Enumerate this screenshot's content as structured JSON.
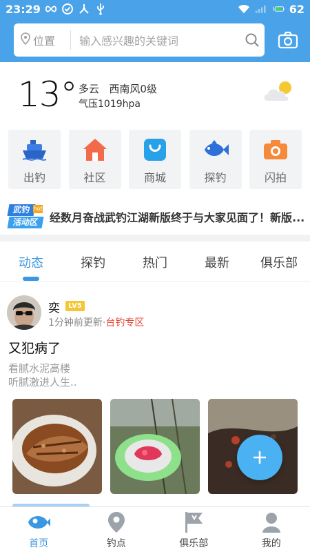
{
  "status_bar": {
    "time": "23:29",
    "battery": "62"
  },
  "header": {
    "location_label": "位置",
    "search_placeholder": "输入感兴趣的关键词"
  },
  "weather": {
    "temperature": "13°",
    "condition": "多云",
    "wind": "西南风0级",
    "pressure": "气压1019hpa"
  },
  "quick_menu": [
    {
      "label": "出钓",
      "icon": "ship-icon"
    },
    {
      "label": "社区",
      "icon": "house-icon"
    },
    {
      "label": "商城",
      "icon": "shopping-bag-icon"
    },
    {
      "label": "探钓",
      "icon": "fish-icon"
    },
    {
      "label": "闪拍",
      "icon": "camera-icon"
    }
  ],
  "banner": {
    "logo_line1": "武钓",
    "logo_line2": "活动区",
    "logo_tag": "hot",
    "text": "经数月奋战武钓江湖新版终于与大家见面了！新版..."
  },
  "tabs": [
    "动态",
    "探钓",
    "热门",
    "最新",
    "俱乐部"
  ],
  "post": {
    "username": "奕",
    "level": "LV5",
    "updated": "1分钟前更新·",
    "zone": "台钓专区",
    "title": "又犯病了",
    "body_line1": "看腻水泥高楼",
    "body_line2": "听腻激进人生.."
  },
  "bottom_nav": [
    {
      "label": "首页",
      "icon": "fish-home-icon"
    },
    {
      "label": "钓点",
      "icon": "map-pin-icon"
    },
    {
      "label": "俱乐部",
      "icon": "flag-icon"
    },
    {
      "label": "我的",
      "icon": "user-icon"
    }
  ],
  "colors": {
    "primary": "#4aa3e8",
    "accent": "#3b97e3",
    "zone_red": "#e0493a",
    "level_badge": "#f5c533"
  }
}
